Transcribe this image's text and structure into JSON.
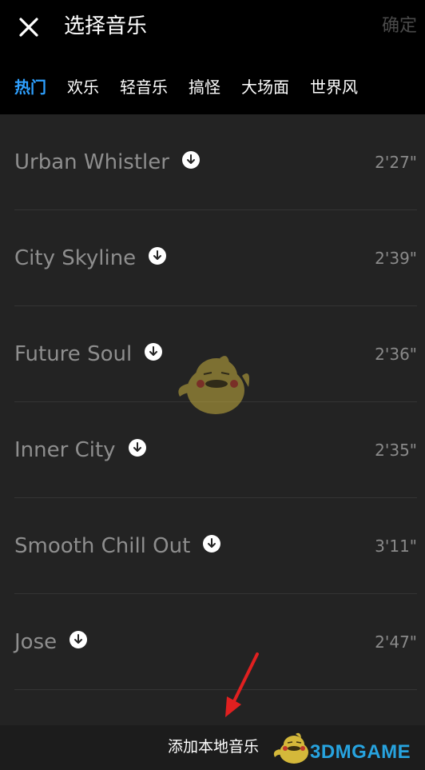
{
  "header": {
    "title": "选择音乐",
    "confirm_label": "确定"
  },
  "tabs": [
    {
      "label": "热门",
      "active": true
    },
    {
      "label": "欢乐"
    },
    {
      "label": "轻音乐"
    },
    {
      "label": "搞怪"
    },
    {
      "label": "大场面"
    },
    {
      "label": "世界风"
    }
  ],
  "tracks": [
    {
      "name": "Urban Whistler",
      "duration": "2'27\""
    },
    {
      "name": "City Skyline",
      "duration": "2'39\""
    },
    {
      "name": "Future Soul",
      "duration": "2'36\""
    },
    {
      "name": "Inner City",
      "duration": "2'35\""
    },
    {
      "name": "Smooth Chill Out",
      "duration": "3'11\""
    },
    {
      "name": "Jose",
      "duration": "2'47\""
    }
  ],
  "footer": {
    "add_local_label": "添加本地音乐"
  },
  "watermark": "3DMGAME",
  "colors": {
    "active_tab": "#2ea0ff",
    "annotation_arrow": "#e02020",
    "watermark": "#27a3df"
  }
}
